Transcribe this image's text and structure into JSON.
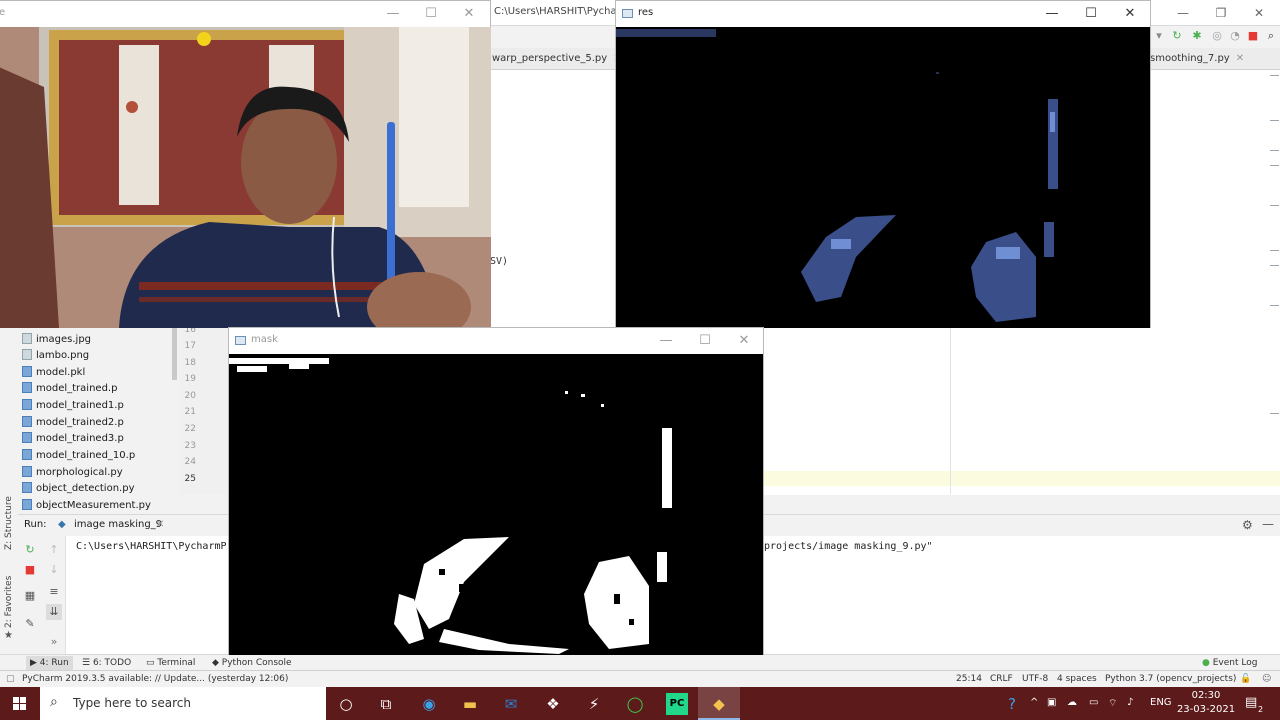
{
  "ide": {
    "title_fragment": "C:\\Users\\HARSHIT\\Pycharm",
    "tabs": [
      {
        "label": "warp_perspective_5.py"
      },
      {
        "label": "smoothing_7.py"
      }
    ],
    "editor_fragment": "SV)",
    "project_files": [
      {
        "name": "images.jpg",
        "type": "image"
      },
      {
        "name": "lambo.png",
        "type": "image"
      },
      {
        "name": "model.pkl",
        "type": "file"
      },
      {
        "name": "model_trained.p",
        "type": "file"
      },
      {
        "name": "model_trained1.p",
        "type": "file"
      },
      {
        "name": "model_trained2.p",
        "type": "file"
      },
      {
        "name": "model_trained3.p",
        "type": "file"
      },
      {
        "name": "model_trained_10.p",
        "type": "file"
      },
      {
        "name": "morphological.py",
        "type": "python"
      },
      {
        "name": "object_detection.py",
        "type": "python"
      },
      {
        "name": "objectMeasurement.py",
        "type": "python"
      }
    ],
    "line_numbers": [
      "16",
      "17",
      "18",
      "19",
      "20",
      "21",
      "22",
      "23",
      "24",
      "25"
    ],
    "current_line": "25",
    "side_labels": {
      "structure": "Z: Structure",
      "favorites": "2: Favorites"
    },
    "run": {
      "label": "Run:",
      "config": "image masking_9",
      "console_left": "C:\\Users\\HARSHIT\\PycharmPr",
      "console_right": "projects/image masking_9.py\""
    },
    "bottom_tabs": {
      "run": "4: Run",
      "todo": "6: TODO",
      "terminal": "Terminal",
      "python_console": "Python Console",
      "event_log": "Event Log"
    },
    "status": {
      "message": "PyCharm 2019.3.5 available: // Update... (yesterday 12:06)",
      "position": "25:14",
      "line_sep": "CRLF",
      "encoding": "UTF-8",
      "indent": "4 spaces",
      "interpreter": "Python 3.7 (opencv_projects)"
    }
  },
  "windows": {
    "frame": {
      "title": "e"
    },
    "res": {
      "title": "res"
    },
    "mask": {
      "title": "mask"
    }
  },
  "taskbar": {
    "search_placeholder": "Type here to search",
    "language": "ENG",
    "time": "02:30",
    "date": "23-03-2021",
    "notification_count": "2"
  },
  "colors": {
    "taskbar_bg": "#5c1a1a",
    "run_green": "#4caf50",
    "stop_red": "#e53935",
    "pen_blue": "#3b6fd1"
  }
}
